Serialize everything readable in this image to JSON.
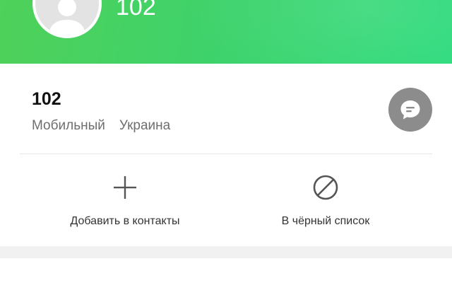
{
  "header": {
    "title": "102",
    "avatar_icon": "person-icon"
  },
  "contact": {
    "number": "102",
    "type": "Мобильный",
    "region": "Украина",
    "message_icon": "chat-bubble-icon"
  },
  "actions": [
    {
      "label": "Добавить в контакты",
      "icon": "plus-icon"
    },
    {
      "label": "В чёрный список",
      "icon": "block-icon"
    }
  ],
  "colors": {
    "header_green": "#3fd26a",
    "message_button": "#8c8c8c"
  }
}
